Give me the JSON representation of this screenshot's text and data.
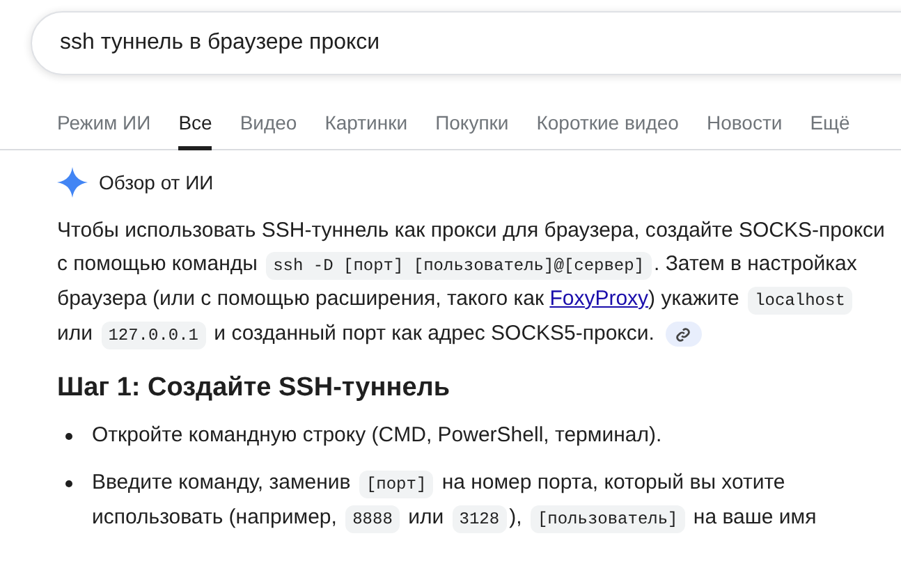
{
  "search": {
    "value": "ssh туннель в браузере прокси"
  },
  "tabs": [
    {
      "label": "Режим ИИ",
      "selected": false
    },
    {
      "label": "Все",
      "selected": true
    },
    {
      "label": "Видео",
      "selected": false
    },
    {
      "label": "Картинки",
      "selected": false
    },
    {
      "label": "Покупки",
      "selected": false
    },
    {
      "label": "Короткие видео",
      "selected": false
    },
    {
      "label": "Новости",
      "selected": false
    },
    {
      "label": "Ещё",
      "selected": false
    }
  ],
  "ai_overview": {
    "title": "Обзор от ИИ",
    "paragraph": [
      {
        "kind": "text",
        "text": "Чтобы использовать SSH-туннель как прокси для браузера, создайте SOCKS-прокси с помощью команды "
      },
      {
        "kind": "code",
        "text": "ssh -D [порт] [пользователь]@[сервер]"
      },
      {
        "kind": "text",
        "text": ". Затем в настройках браузера (или с помощью расширения, такого как "
      },
      {
        "kind": "link",
        "text": "FoxyProxy"
      },
      {
        "kind": "text",
        "text": ") укажите "
      },
      {
        "kind": "code",
        "text": "localhost"
      },
      {
        "kind": "text",
        "text": " или "
      },
      {
        "kind": "code",
        "text": "127.0.0.1"
      },
      {
        "kind": "text",
        "text": " и созданный порт как адрес SOCKS5-прокси."
      }
    ],
    "step": {
      "heading": "Шаг 1: Создайте SSH-туннель",
      "bullets": [
        [
          {
            "kind": "text",
            "text": "Откройте командную строку (CMD, PowerShell, терминал)."
          }
        ],
        [
          {
            "kind": "text",
            "text": "Введите команду, заменив "
          },
          {
            "kind": "code",
            "text": "[порт]"
          },
          {
            "kind": "text",
            "text": " на номер порта, который вы хотите использовать (например, "
          },
          {
            "kind": "code",
            "text": "8888"
          },
          {
            "kind": "text",
            "text": " или "
          },
          {
            "kind": "code",
            "text": "3128"
          },
          {
            "kind": "text",
            "text": "), "
          },
          {
            "kind": "code",
            "text": "[пользователь]"
          },
          {
            "kind": "text",
            "text": " на ваше имя"
          }
        ]
      ]
    }
  }
}
